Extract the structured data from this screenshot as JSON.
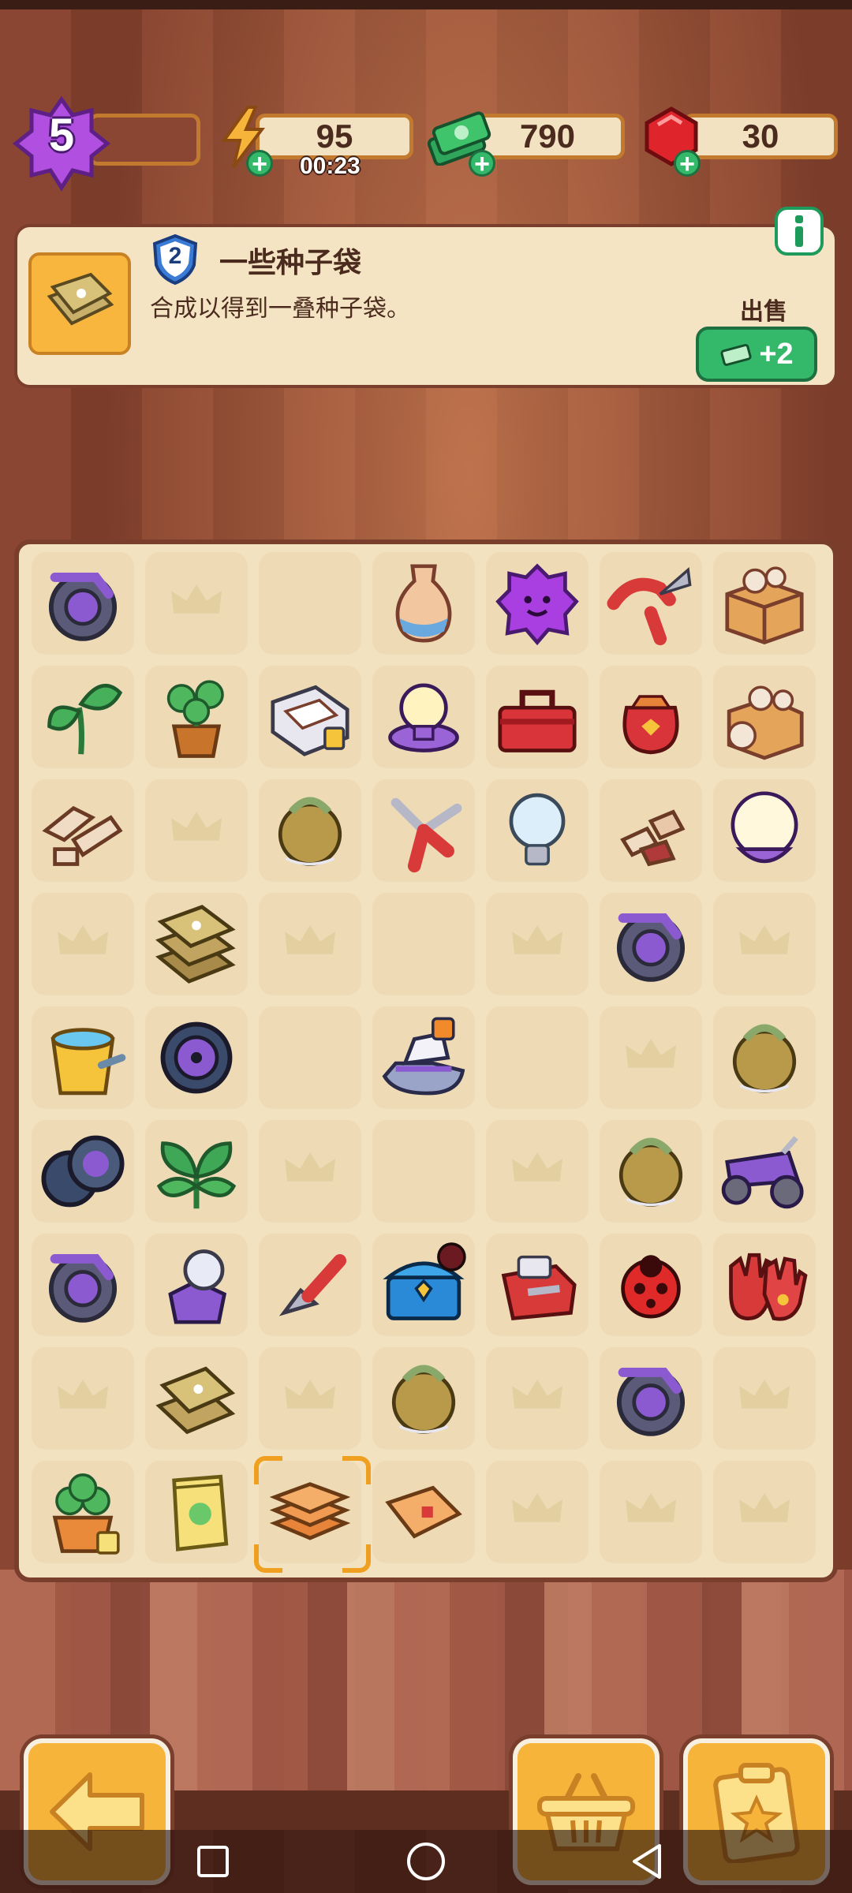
{
  "player": {
    "level": "5"
  },
  "resources": {
    "energy": {
      "value": "95",
      "timer": "00:23"
    },
    "cash": {
      "value": "790"
    },
    "gems": {
      "value": "30"
    }
  },
  "item_panel": {
    "level": "2",
    "title": "一些种子袋",
    "description": "合成以得到一叠种子袋。",
    "sell_label": "出售",
    "sell_value": "+2"
  },
  "board": {
    "columns": 7,
    "rows": 9,
    "selected": "row8-col2",
    "cells": [
      [
        "bicycle-frame",
        "crown",
        "empty",
        "vase",
        "purple-slime",
        "pruning-shears",
        "cardboard-box"
      ],
      [
        "sprout-plant",
        "potted-plant",
        "seed-packet-box",
        "lamp-bulb",
        "toolbox",
        "red-pouch",
        "cardboard-box-pots"
      ],
      [
        "wood-pieces",
        "crown",
        "vine-basket",
        "open-shears",
        "light-bulb",
        "wood-chips",
        "globe-lamp"
      ],
      [
        "crown",
        "seed-bag-stack",
        "crown",
        "empty",
        "crown",
        "bicycle-frame",
        "crown"
      ],
      [
        "water-bucket",
        "bike-wheel",
        "empty",
        "jet-ski",
        "empty",
        "crown",
        "vine-basket"
      ],
      [
        "bike-wheels",
        "leafy-greens",
        "crown",
        "empty",
        "crown",
        "vine-basket",
        "purple-motorbike"
      ],
      [
        "bicycle-frame",
        "crystal-ball",
        "trowel",
        "treasure-chest",
        "red-machine",
        "ladybug",
        "work-gloves"
      ],
      [
        "crown",
        "seed-bags",
        "crown",
        "vine-basket",
        "crown",
        "bicycle-frame",
        "crown"
      ],
      [
        "potted-clover",
        "seed-packet",
        "orange-tiles",
        "orange-cloth",
        "crown",
        "crown",
        "crown"
      ]
    ]
  },
  "colors": {
    "accent": "#f6b43a",
    "panel": "#f5e4c3",
    "green": "#34b86a",
    "border": "#7a3e2c"
  }
}
